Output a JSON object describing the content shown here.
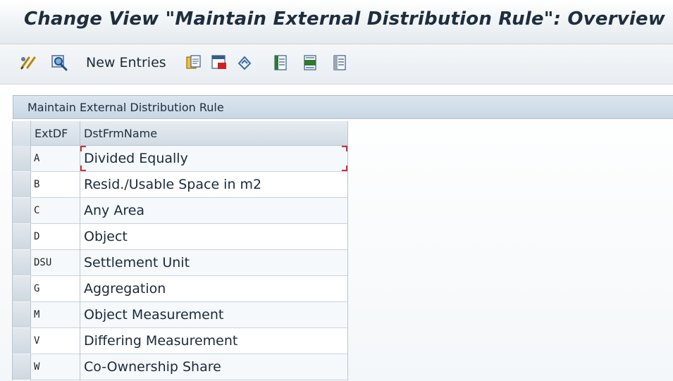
{
  "window": {
    "title": "Change View \"Maintain External Distribution Rule\": Overview"
  },
  "toolbar": {
    "icons_left": [
      "edit-glasses-icon",
      "find-icon"
    ],
    "new_entries_label": "New Entries",
    "icons_right": [
      "copy-as-icon",
      "delete-icon",
      "undo-change-icon",
      "select-all-icon",
      "select-block-icon",
      "deselect-all-icon"
    ]
  },
  "panel": {
    "title": "Maintain External Distribution Rule"
  },
  "table": {
    "columns": [
      "ExtDF",
      "DstFrmName"
    ],
    "rows": [
      {
        "code": "A",
        "name": "Divided Equally"
      },
      {
        "code": "B",
        "name": "Resid./Usable Space in m2"
      },
      {
        "code": "C",
        "name": "Any Area"
      },
      {
        "code": "D",
        "name": "Object"
      },
      {
        "code": "DSU",
        "name": "Settlement Unit"
      },
      {
        "code": "G",
        "name": "Aggregation"
      },
      {
        "code": "M",
        "name": "Object Measurement"
      },
      {
        "code": "V",
        "name": "Differing Measurement"
      },
      {
        "code": "W",
        "name": "Co-Ownership Share"
      }
    ],
    "focused_row": 0
  },
  "colors": {
    "title_text": "#1e2e3e",
    "panel_header": "#c9d7e5",
    "focus_marker": "#d03030"
  }
}
